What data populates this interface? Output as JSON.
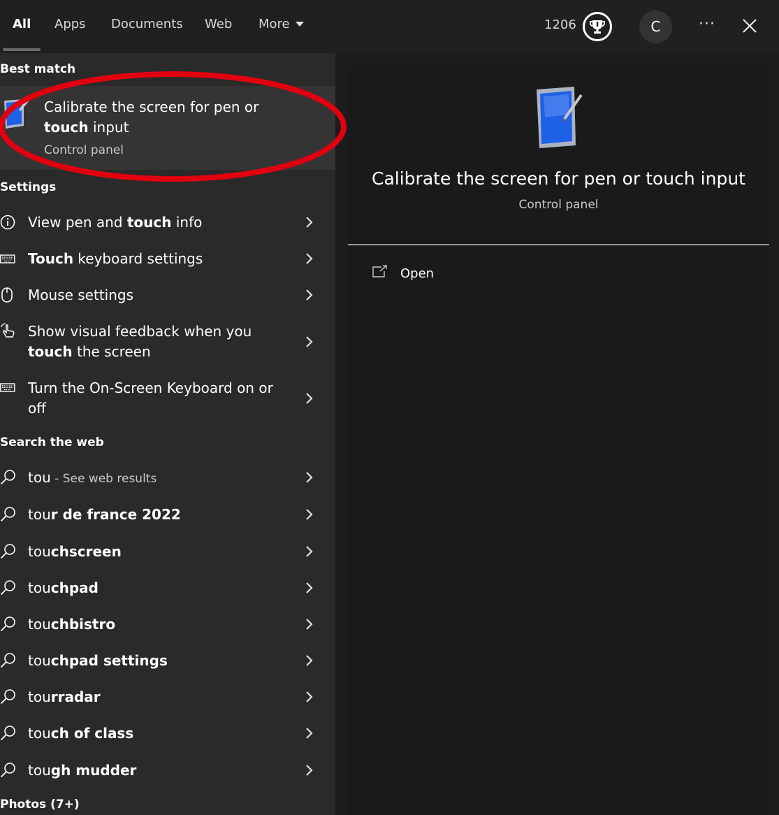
{
  "topbar": {
    "tabs": [
      {
        "label": "All",
        "active": true
      },
      {
        "label": "Apps"
      },
      {
        "label": "Documents"
      },
      {
        "label": "Web"
      },
      {
        "label": "More"
      }
    ],
    "points": "1206",
    "avatar_initial": "C",
    "more_options": "···"
  },
  "best_match": {
    "heading": "Best match",
    "title_pre": "Calibrate the screen for pen or ",
    "title_bold": "touch",
    "title_post": " input",
    "subtitle": "Control panel"
  },
  "settings": {
    "heading": "Settings",
    "items": [
      {
        "pre": "View pen and ",
        "bold": "touch",
        "post": " info",
        "icon": "info-icon"
      },
      {
        "pre": "",
        "bold": "Touch",
        "post": " keyboard settings",
        "icon": "keyboard-icon"
      },
      {
        "pre": "Mouse settings",
        "bold": "",
        "post": "",
        "icon": "mouse-icon"
      },
      {
        "pre": "Show visual feedback when you ",
        "bold": "touch",
        "post": " the screen",
        "icon": "touch-hand-icon"
      },
      {
        "pre": "Turn the On-Screen Keyboard on or off",
        "bold": "",
        "post": "",
        "icon": "keyboard-icon"
      }
    ]
  },
  "web": {
    "heading": "Search the web",
    "items": [
      {
        "pre": "tou",
        "bold": "",
        "hint": " - See web results"
      },
      {
        "pre": "tou",
        "bold": "r de france 2022",
        "hint": ""
      },
      {
        "pre": "tou",
        "bold": "chscreen",
        "hint": ""
      },
      {
        "pre": "tou",
        "bold": "chpad",
        "hint": ""
      },
      {
        "pre": "tou",
        "bold": "chbistro",
        "hint": ""
      },
      {
        "pre": "tou",
        "bold": "chpad settings",
        "hint": ""
      },
      {
        "pre": "tou",
        "bold": "rradar",
        "hint": ""
      },
      {
        "pre": "tou",
        "bold": "ch of class",
        "hint": ""
      },
      {
        "pre": "tou",
        "bold": "gh mudder",
        "hint": ""
      }
    ]
  },
  "photos": {
    "heading": "Photos (7+)"
  },
  "preview": {
    "title": "Calibrate the screen for pen or touch input",
    "subtitle": "Control panel",
    "open_label": "Open"
  },
  "colors": {
    "annotation": "#e0000f",
    "tab_indicator": "#6b6b6b",
    "icon_blue": "#1e60e6"
  }
}
